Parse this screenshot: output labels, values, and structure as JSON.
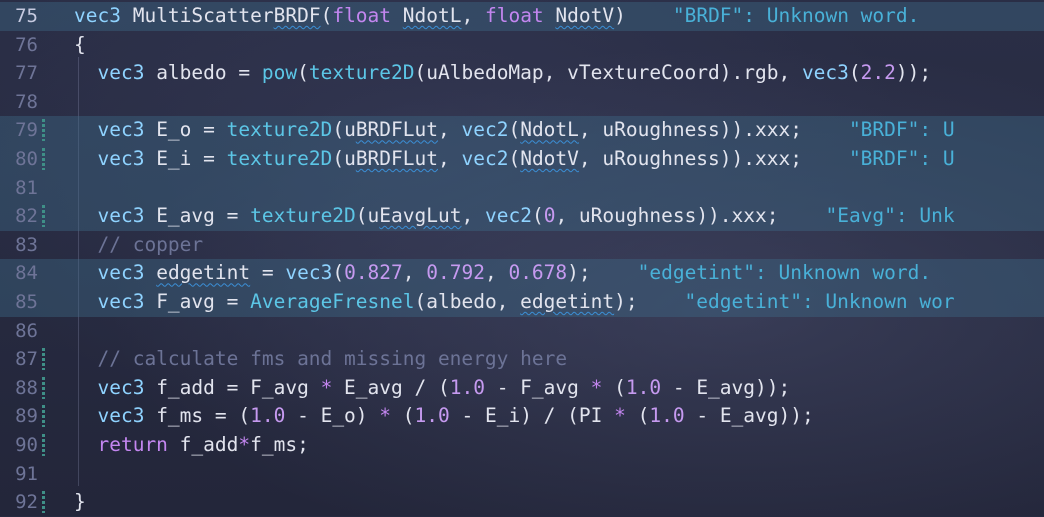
{
  "colors": {
    "background": "#262a40",
    "line_highlight": "#3e6e8c",
    "type": "#8fd3ff",
    "keyword": "#c386f0",
    "function": "#5cc6e6",
    "number": "#c69af0",
    "comment": "#6c7396",
    "diagnostic": "#49b1d8"
  },
  "editor": {
    "lines": [
      {
        "n": "75",
        "active": true,
        "hl": true,
        "mark": false,
        "tokens": [
          [
            "t",
            "vec3"
          ],
          [
            "pl",
            " Multi"
          ],
          [
            "pl",
            "Scatter"
          ],
          [
            "sq",
            "BRDF"
          ],
          [
            "pl",
            "("
          ],
          [
            "kw",
            "float"
          ],
          [
            "pl",
            " "
          ],
          [
            "sq",
            "NdotL"
          ],
          [
            "pl",
            ", "
          ],
          [
            "kw",
            "float"
          ],
          [
            "pl",
            " "
          ],
          [
            "sq",
            "NdotV"
          ],
          [
            "pl",
            ")"
          ]
        ],
        "diag": "\"BRDF\": Unknown word.",
        "diagPad": "    "
      },
      {
        "n": "76",
        "active": false,
        "hl": false,
        "mark": false,
        "tokens": [
          [
            "pl",
            "{"
          ]
        ],
        "diag": "",
        "diagPad": ""
      },
      {
        "n": "77",
        "active": false,
        "hl": false,
        "mark": false,
        "tokens": [
          [
            "pl",
            "  "
          ],
          [
            "t",
            "vec3"
          ],
          [
            "pl",
            " albedo = "
          ],
          [
            "fn",
            "pow"
          ],
          [
            "pl",
            "("
          ],
          [
            "fn",
            "texture2D"
          ],
          [
            "pl",
            "(uAlbedoMap, vTextureCoord).rgb, "
          ],
          [
            "t",
            "vec3"
          ],
          [
            "pl",
            "("
          ],
          [
            "num",
            "2.2"
          ],
          [
            "pl",
            "));"
          ]
        ],
        "diag": "",
        "diagPad": ""
      },
      {
        "n": "78",
        "active": false,
        "hl": false,
        "mark": false,
        "tokens": [],
        "diag": "",
        "diagPad": ""
      },
      {
        "n": "79",
        "active": false,
        "hl": true,
        "mark": true,
        "tokens": [
          [
            "pl",
            "  "
          ],
          [
            "t",
            "vec3"
          ],
          [
            "pl",
            " E_o = "
          ],
          [
            "fn",
            "texture2D"
          ],
          [
            "pl",
            "("
          ],
          [
            "pl",
            "u"
          ],
          [
            "sq",
            "BRDFLut"
          ],
          [
            "pl",
            ", "
          ],
          [
            "t",
            "vec2"
          ],
          [
            "pl",
            "("
          ],
          [
            "sq",
            "NdotL"
          ],
          [
            "pl",
            ", uRoughness)).xxx;"
          ]
        ],
        "diag": "\"BRDF\": U",
        "diagPad": "    "
      },
      {
        "n": "80",
        "active": false,
        "hl": true,
        "mark": true,
        "tokens": [
          [
            "pl",
            "  "
          ],
          [
            "t",
            "vec3"
          ],
          [
            "pl",
            " E_i = "
          ],
          [
            "fn",
            "texture2D"
          ],
          [
            "pl",
            "("
          ],
          [
            "pl",
            "u"
          ],
          [
            "sq",
            "BRDFLut"
          ],
          [
            "pl",
            ", "
          ],
          [
            "t",
            "vec2"
          ],
          [
            "pl",
            "("
          ],
          [
            "sq",
            "NdotV"
          ],
          [
            "pl",
            ", uRoughness)).xxx;"
          ]
        ],
        "diag": "\"BRDF\": U",
        "diagPad": "    "
      },
      {
        "n": "81",
        "active": false,
        "hl": true,
        "mark": false,
        "tokens": [],
        "diag": "",
        "diagPad": ""
      },
      {
        "n": "82",
        "active": false,
        "hl": true,
        "mark": true,
        "tokens": [
          [
            "pl",
            "  "
          ],
          [
            "t",
            "vec3"
          ],
          [
            "pl",
            " E_avg = "
          ],
          [
            "fn",
            "texture2D"
          ],
          [
            "pl",
            "("
          ],
          [
            "pl",
            "u"
          ],
          [
            "sq",
            "EavgLut"
          ],
          [
            "pl",
            ", "
          ],
          [
            "t",
            "vec2"
          ],
          [
            "pl",
            "("
          ],
          [
            "num",
            "0"
          ],
          [
            "pl",
            ", uRoughness)).xxx;"
          ]
        ],
        "diag": "\"Eavg\": Unk",
        "diagPad": "    "
      },
      {
        "n": "83",
        "active": false,
        "hl": false,
        "mark": false,
        "tokens": [
          [
            "pl",
            "  "
          ],
          [
            "cm",
            "// copper"
          ]
        ],
        "diag": "",
        "diagPad": ""
      },
      {
        "n": "84",
        "active": false,
        "hl": true,
        "mark": false,
        "tokens": [
          [
            "pl",
            "  "
          ],
          [
            "t",
            "vec3"
          ],
          [
            "pl",
            " "
          ],
          [
            "sq",
            "edgetint"
          ],
          [
            "pl",
            " = "
          ],
          [
            "t",
            "vec3"
          ],
          [
            "pl",
            "("
          ],
          [
            "num",
            "0.827"
          ],
          [
            "pl",
            ", "
          ],
          [
            "num",
            "0.792"
          ],
          [
            "pl",
            ", "
          ],
          [
            "num",
            "0.678"
          ],
          [
            "pl",
            ");"
          ]
        ],
        "diag": "\"edgetint\": Unknown word.",
        "diagPad": "    "
      },
      {
        "n": "85",
        "active": false,
        "hl": true,
        "mark": false,
        "tokens": [
          [
            "pl",
            "  "
          ],
          [
            "t",
            "vec3"
          ],
          [
            "pl",
            " F_avg = "
          ],
          [
            "fn",
            "AverageFresnel"
          ],
          [
            "pl",
            "(albedo, "
          ],
          [
            "sq",
            "edgetint"
          ],
          [
            "pl",
            ");"
          ]
        ],
        "diag": "\"edgetint\": Unknown wor",
        "diagPad": "    "
      },
      {
        "n": "86",
        "active": false,
        "hl": false,
        "mark": false,
        "tokens": [],
        "diag": "",
        "diagPad": ""
      },
      {
        "n": "87",
        "active": false,
        "hl": false,
        "mark": true,
        "tokens": [
          [
            "pl",
            "  "
          ],
          [
            "cm",
            "// calculate fms and missing energy here"
          ]
        ],
        "diag": "",
        "diagPad": ""
      },
      {
        "n": "88",
        "active": false,
        "hl": false,
        "mark": true,
        "tokens": [
          [
            "pl",
            "  "
          ],
          [
            "t",
            "vec3"
          ],
          [
            "pl",
            " f_add = F_avg "
          ],
          [
            "kw",
            "*"
          ],
          [
            "pl",
            " E_avg / ("
          ],
          [
            "num",
            "1.0"
          ],
          [
            "pl",
            " - F_avg "
          ],
          [
            "kw",
            "*"
          ],
          [
            "pl",
            " ("
          ],
          [
            "num",
            "1.0"
          ],
          [
            "pl",
            " - E_avg));"
          ]
        ],
        "diag": "",
        "diagPad": ""
      },
      {
        "n": "89",
        "active": false,
        "hl": false,
        "mark": true,
        "tokens": [
          [
            "pl",
            "  "
          ],
          [
            "t",
            "vec3"
          ],
          [
            "pl",
            " f_ms = ("
          ],
          [
            "num",
            "1.0"
          ],
          [
            "pl",
            " - E_o) "
          ],
          [
            "kw",
            "*"
          ],
          [
            "pl",
            " ("
          ],
          [
            "num",
            "1.0"
          ],
          [
            "pl",
            " - E_i) / (PI "
          ],
          [
            "kw",
            "*"
          ],
          [
            "pl",
            " ("
          ],
          [
            "num",
            "1.0"
          ],
          [
            "pl",
            " - E_avg));"
          ]
        ],
        "diag": "",
        "diagPad": ""
      },
      {
        "n": "90",
        "active": false,
        "hl": false,
        "mark": true,
        "tokens": [
          [
            "pl",
            "  "
          ],
          [
            "kw",
            "return"
          ],
          [
            "pl",
            " f_add"
          ],
          [
            "kw",
            "*"
          ],
          [
            "pl",
            "f_ms;"
          ]
        ],
        "diag": "",
        "diagPad": ""
      },
      {
        "n": "91",
        "active": false,
        "hl": false,
        "mark": false,
        "tokens": [],
        "diag": "",
        "diagPad": ""
      },
      {
        "n": "92",
        "active": false,
        "hl": false,
        "mark": true,
        "tokens": [
          [
            "pl",
            "}"
          ]
        ],
        "diag": "",
        "diagPad": ""
      }
    ]
  }
}
